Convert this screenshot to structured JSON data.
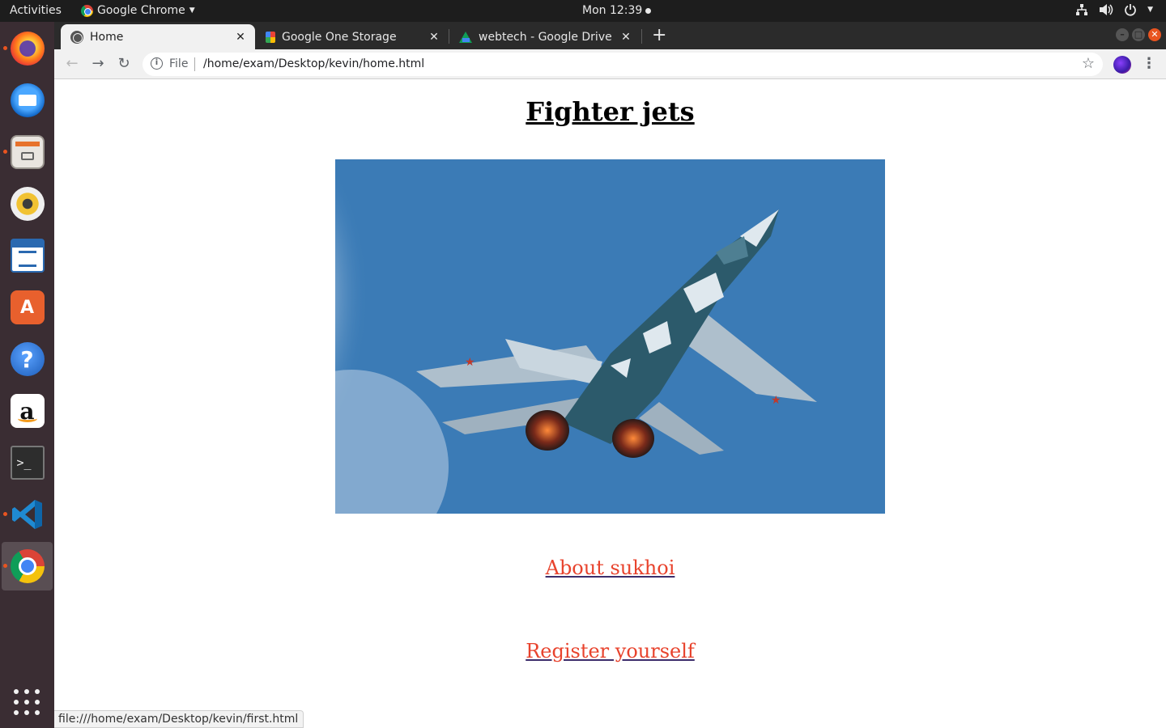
{
  "topbar": {
    "activities": "Activities",
    "app_name": "Google Chrome",
    "clock": "Mon 12:39"
  },
  "dock": {
    "items": [
      {
        "name": "firefox-icon",
        "running": true
      },
      {
        "name": "thunderbird-icon",
        "running": false
      },
      {
        "name": "files-icon",
        "running": true
      },
      {
        "name": "rhythmbox-icon",
        "running": false
      },
      {
        "name": "libreoffice-writer-icon",
        "running": false
      },
      {
        "name": "ubuntu-software-icon",
        "running": false
      },
      {
        "name": "help-icon",
        "running": false
      },
      {
        "name": "amazon-icon",
        "running": false
      },
      {
        "name": "terminal-icon",
        "running": false
      },
      {
        "name": "vscode-icon",
        "running": true
      },
      {
        "name": "chrome-icon",
        "running": true
      }
    ]
  },
  "browser": {
    "tabs": [
      {
        "title": "Home",
        "active": true
      },
      {
        "title": "Google One Storage",
        "active": false
      },
      {
        "title": "webtech - Google Drive",
        "active": false
      }
    ],
    "address": {
      "scheme_label": "File",
      "url": "/home/exam/Desktop/kevin/home.html"
    },
    "status_url": "file:///home/exam/Desktop/kevin/first.html"
  },
  "page": {
    "heading": "Fighter jets",
    "links": [
      {
        "text": "About sukhoi"
      },
      {
        "text": "Register yourself"
      }
    ]
  },
  "colors": {
    "link": "#e8432d",
    "accent": "#e95420",
    "sky": "#3b7bb6"
  }
}
